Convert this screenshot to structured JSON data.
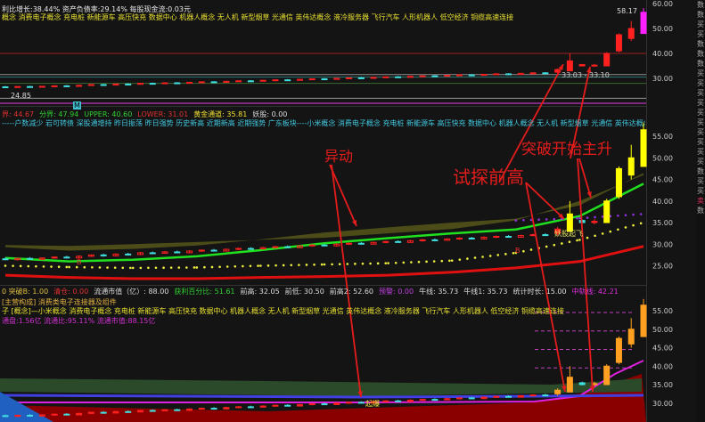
{
  "top_panel": {
    "fundamentals": "利比增长:38.44%  资产负债率:29.14%  每股现金流:0.03元",
    "concepts": "概念 消费电子概念 充电桩 新能源车 高压快充 数据中心 机器人概念 无人机 新型烟草 光通信 英伟达概念 液冷服务器 飞行汽车 人形机器人 低空经济 铜缆高速连接",
    "high_label": "58.17",
    "range_label": "33.03 - 33.10",
    "low_label": "24.85",
    "badge": "M",
    "axis": [
      "60.00",
      "50.00",
      "40.00",
      "30.00"
    ]
  },
  "middle_panel": {
    "indicators": [
      {
        "label": "界: 44.67",
        "color": "#e03030"
      },
      {
        "label": "分界: 47.94",
        "color": "#30d030"
      },
      {
        "label": "UPPER: 40.60",
        "color": "#30d030"
      },
      {
        "label": "LOWER: 31.01",
        "color": "#e03030"
      },
      {
        "label": "黄金通道: 35.81",
        "color": "#f0e030"
      },
      {
        "label": "妖股: 0.00",
        "color": "#dddddd"
      }
    ],
    "tags": "-----户数减少 岩可转债 深股通增持 昨日振荡 昨日强势 历史新高 近期新高 近期强势 广东板块----小米概念 消费电子概念 充电桩 新能源车 高压快充 数据中心 机器人概念 无人机 新型烟草 光通信 英伟达概念 液冷服务器 飞行汽车 人形机器人 低空经济",
    "signal_label": "妖股起飞",
    "buy_marker": "B",
    "axis": [
      "55.00",
      "50.00",
      "45.00",
      "40.00",
      "35.00",
      "30.00",
      "25.00"
    ]
  },
  "bottom_panel": {
    "indicators": [
      {
        "label": "0 突破B: 1.00",
        "color": "#e0c040"
      },
      {
        "label": "清仓: 0.00",
        "color": "#e03030"
      },
      {
        "label": "流通市值（亿）: 88.00",
        "color": "#dddddd"
      },
      {
        "label": "获利百分比: 51.61",
        "color": "#30d030"
      },
      {
        "label": "前高: 32.05",
        "color": "#dddddd"
      },
      {
        "label": "前低: 30.50",
        "color": "#dddddd"
      },
      {
        "label": "前高2: 52.60",
        "color": "#dddddd"
      },
      {
        "label": "预警: 0.00",
        "color": "#c040e0"
      },
      {
        "label": "牛线: 35.73",
        "color": "#dddddd"
      },
      {
        "label": "牛线1: 35.73",
        "color": "#dddddd"
      },
      {
        "label": "统计时长: 15.00",
        "color": "#dddddd"
      },
      {
        "label": "中轨线: 42.21",
        "color": "#e030e0"
      }
    ],
    "business": "[主营构成] 消费类电子连接器及组件",
    "concepts": "子 [概念]—小米概念 消费电子概念 充电桩 新能源车 高压快充 数据中心 机器人概念 无人机 新型烟草 光通信 英伟达概念 液冷服务器 飞行汽车 人形机器人 低空经济 铜缆高速连接",
    "shares": "通盘:1.56亿  流通比:95.11%  流通市值:88.15亿",
    "signal_label": "起爆",
    "axis": [
      "55.00",
      "50.00",
      "45.00",
      "40.00",
      "35.00",
      "30.00"
    ]
  },
  "annotations": {
    "move": "异动",
    "test_high": "试探前高",
    "breakout": "突破开始主升"
  },
  "right_strip": [
    "数",
    "数",
    "买",
    "买",
    "数",
    "数",
    "数",
    "买",
    "买",
    "买",
    "买",
    "买",
    "买",
    "买",
    "买",
    "买",
    "买",
    "数",
    "买",
    "买",
    "卖",
    "数"
  ],
  "colors": {
    "up": "#ff2020",
    "down": "#40e0e0",
    "abnormal": "#ffff00",
    "annotation": "#e51c1c",
    "ma_green": "#20e020",
    "upper_band": "#5a5a1a",
    "lower_line": "#e01010"
  },
  "chart_data": {
    "type": "candlestick",
    "ohlc": [
      [
        26.6,
        26.9,
        26.3,
        26.4
      ],
      [
        26.4,
        26.8,
        26.2,
        26.7
      ],
      [
        26.7,
        27.0,
        26.4,
        26.5
      ],
      [
        26.5,
        26.9,
        26.3,
        26.8
      ],
      [
        26.8,
        27.2,
        26.6,
        27.0
      ],
      [
        27.0,
        27.3,
        26.7,
        26.8
      ],
      [
        26.8,
        27.4,
        26.7,
        27.2
      ],
      [
        27.2,
        27.6,
        27.0,
        27.5
      ],
      [
        27.5,
        27.8,
        27.1,
        27.3
      ],
      [
        27.3,
        27.9,
        27.2,
        27.7
      ],
      [
        27.7,
        28.0,
        27.4,
        27.6
      ],
      [
        27.6,
        28.2,
        27.5,
        28.0
      ],
      [
        28.0,
        28.3,
        27.7,
        27.9
      ],
      [
        27.9,
        28.4,
        27.8,
        28.2
      ],
      [
        28.2,
        28.5,
        27.9,
        28.0
      ],
      [
        28.0,
        28.6,
        27.9,
        28.4
      ],
      [
        28.4,
        28.8,
        28.2,
        28.6
      ],
      [
        28.6,
        28.9,
        28.3,
        28.4
      ],
      [
        28.4,
        29.0,
        28.3,
        28.8
      ],
      [
        28.8,
        29.2,
        28.6,
        29.0
      ],
      [
        29.0,
        29.3,
        28.7,
        28.9
      ],
      [
        28.9,
        29.4,
        28.8,
        29.2
      ],
      [
        29.2,
        29.6,
        29.0,
        29.4
      ],
      [
        29.4,
        29.7,
        29.1,
        29.2
      ],
      [
        29.2,
        29.8,
        29.1,
        29.6
      ],
      [
        29.6,
        30.0,
        29.4,
        29.8
      ],
      [
        29.8,
        30.1,
        29.5,
        29.6
      ],
      [
        29.6,
        30.2,
        29.5,
        30.0
      ],
      [
        30.0,
        30.4,
        29.8,
        30.2
      ],
      [
        30.2,
        30.5,
        29.9,
        30.0
      ],
      [
        30.0,
        30.6,
        29.9,
        30.4
      ],
      [
        30.4,
        30.8,
        30.2,
        30.6
      ],
      [
        30.6,
        30.9,
        30.3,
        30.4
      ],
      [
        30.4,
        31.0,
        30.3,
        30.8
      ],
      [
        30.8,
        31.2,
        30.6,
        31.0
      ],
      [
        31.0,
        31.3,
        30.7,
        30.9
      ],
      [
        30.9,
        31.4,
        30.8,
        31.2
      ],
      [
        31.2,
        31.6,
        31.0,
        31.4
      ],
      [
        31.4,
        31.7,
        31.1,
        31.2
      ],
      [
        31.2,
        31.8,
        31.1,
        31.6
      ],
      [
        31.6,
        32.0,
        31.4,
        31.8
      ],
      [
        31.8,
        32.1,
        31.5,
        31.6
      ],
      [
        31.6,
        32.2,
        31.5,
        32.0
      ],
      [
        32.0,
        32.4,
        31.8,
        32.2
      ],
      [
        32.2,
        32.5,
        31.9,
        32.0
      ],
      [
        32.5,
        34.0,
        32.0,
        33.5
      ],
      [
        33.0,
        40.0,
        33.0,
        37.0
      ],
      [
        35.5,
        35.8,
        34.8,
        35.0
      ],
      [
        35.0,
        35.8,
        34.6,
        35.3
      ],
      [
        35.0,
        40.5,
        35.0,
        40.0
      ],
      [
        41.0,
        48.0,
        40.5,
        47.5
      ],
      [
        46.0,
        53.0,
        45.0,
        50.0
      ],
      [
        48.0,
        58.17,
        48.0,
        56.5
      ]
    ],
    "ma_green": [
      26.8,
      26.0,
      26.4,
      27.2,
      28.6,
      30.2,
      31.4,
      32.5,
      33.4,
      36.5,
      44.0
    ],
    "upper_band": [
      29.8,
      29.6,
      30.0,
      30.5,
      31.0,
      31.5,
      32.5,
      33.5,
      35.5,
      40.0,
      46.0
    ],
    "lower_line": [
      22.8,
      22.3,
      22.0,
      22.0,
      22.3,
      22.5,
      22.8,
      23.5,
      24.5,
      26.0,
      29.5
    ],
    "yellow_dots": [
      25.0,
      24.7,
      24.5,
      24.6,
      25.0,
      25.3,
      25.6,
      26.2,
      28.0,
      31.0,
      35.0
    ],
    "purple_dots": [
      null,
      null,
      null,
      null,
      null,
      null,
      null,
      null,
      35.5,
      36.0,
      37.0
    ]
  }
}
